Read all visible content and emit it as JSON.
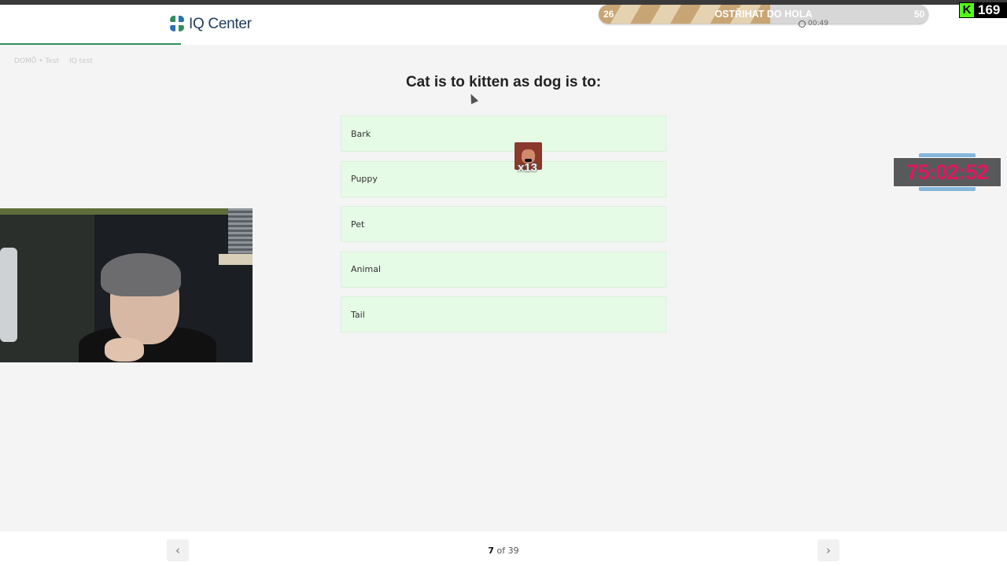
{
  "header": {
    "logo_text": "IQ Center",
    "breadcrumb": [
      "DOMŮ • Test",
      "IQ test"
    ]
  },
  "question": {
    "text": "Cat is to kitten as dog is to:",
    "options": [
      "Bark",
      "Puppy",
      "Pet",
      "Animal",
      "Tail"
    ]
  },
  "pagination": {
    "current": "7",
    "of_label": "of 39",
    "prev_icon": "chevron-left-icon",
    "next_icon": "chevron-right-icon"
  },
  "overlay": {
    "goal": {
      "start": "26",
      "title": "OSTŘIHAT DO HOLA",
      "end": "50",
      "progress_fraction": 0.52
    },
    "quiz_timer": "00:49",
    "kick_count": "169",
    "kick_badge_letter": "K",
    "subathon_timer": "75:02:52",
    "emote_count": "x13"
  },
  "colors": {
    "option_bg": "#e6fbe6",
    "progress_accent": "#2f8f5e",
    "subathon_digits": "#e0175f",
    "kick_green": "#53fc18"
  }
}
